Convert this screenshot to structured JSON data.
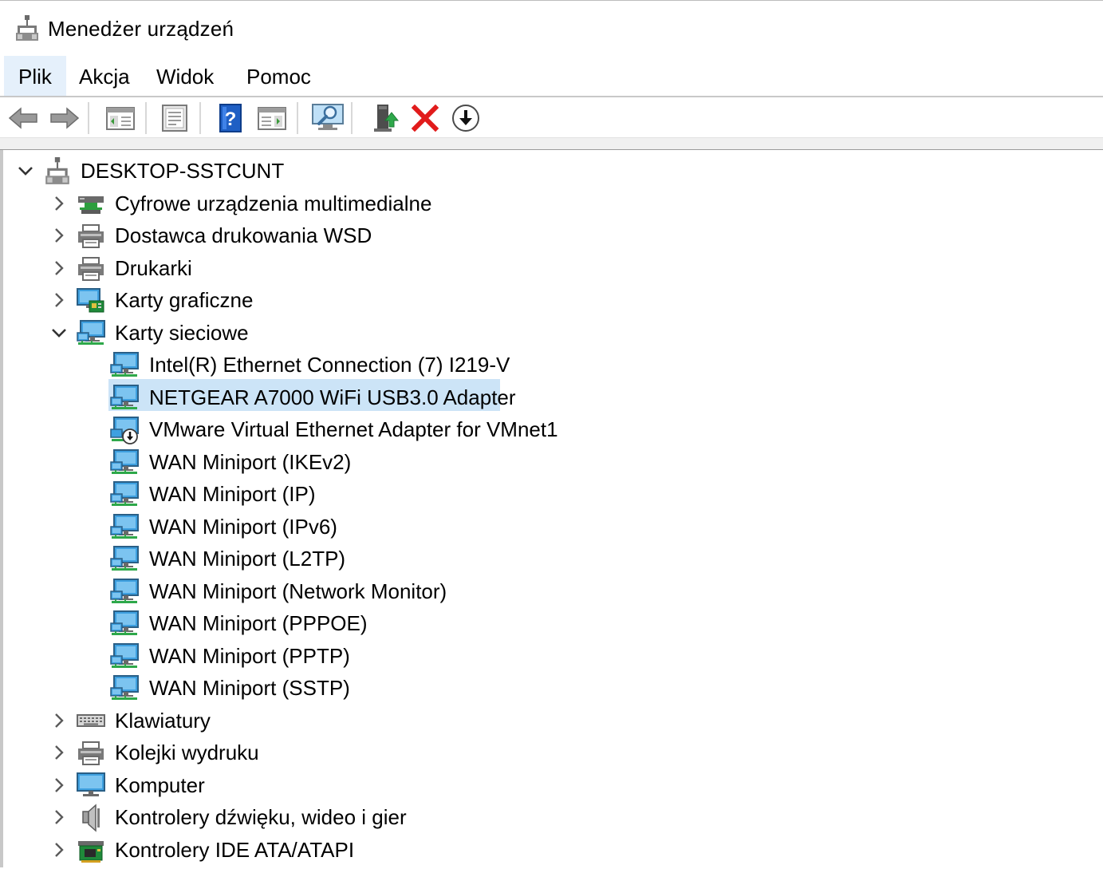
{
  "window": {
    "title": "Menedżer urządzeń",
    "icon": "device-manager-icon"
  },
  "menu": [
    "Plik",
    "Akcja",
    "Widok",
    "Pomoc"
  ],
  "menu_active": "Plik",
  "toolbar": [
    {
      "name": "back-button",
      "icon": "arrow-left-icon"
    },
    {
      "name": "forward-button",
      "icon": "arrow-right-icon"
    },
    {
      "name": "show-hide-console-tree-button",
      "icon": "console-tree-icon"
    },
    {
      "name": "properties-button",
      "icon": "properties-icon"
    },
    {
      "name": "help-button",
      "icon": "help-icon"
    },
    {
      "name": "show-hide-action-pane-button",
      "icon": "action-pane-icon"
    },
    {
      "name": "scan-hardware-button",
      "icon": "monitor-scan-icon"
    },
    {
      "name": "update-driver-button",
      "icon": "update-driver-icon"
    },
    {
      "name": "uninstall-device-button",
      "icon": "red-x-icon"
    },
    {
      "name": "disable-device-button",
      "icon": "download-circle-icon"
    }
  ],
  "tree": {
    "root": {
      "label": "DESKTOP-SSTCUNT",
      "icon": "computer-network-icon",
      "expanded": true
    },
    "categories": [
      {
        "label": "Cyfrowe urządzenia multimedialne",
        "icon": "multimedia-device-icon",
        "expanded": false
      },
      {
        "label": "Dostawca drukowania WSD",
        "icon": "printer-icon",
        "expanded": false
      },
      {
        "label": "Drukarki",
        "icon": "printer-icon",
        "expanded": false
      },
      {
        "label": "Karty graficzne",
        "icon": "display-adapter-icon",
        "expanded": false
      },
      {
        "label": "Karty sieciowe",
        "icon": "network-adapter-icon",
        "expanded": true,
        "children": [
          {
            "label": "Intel(R) Ethernet Connection (7) I219-V",
            "icon": "network-adapter-icon"
          },
          {
            "label": "NETGEAR A7000 WiFi USB3.0 Adapter",
            "icon": "network-adapter-icon",
            "selected": true
          },
          {
            "label": "VMware Virtual Ethernet Adapter for VMnet1",
            "icon": "network-adapter-disabled-icon"
          },
          {
            "label": "WAN Miniport (IKEv2)",
            "icon": "network-adapter-icon"
          },
          {
            "label": "WAN Miniport (IP)",
            "icon": "network-adapter-icon"
          },
          {
            "label": "WAN Miniport (IPv6)",
            "icon": "network-adapter-icon"
          },
          {
            "label": "WAN Miniport (L2TP)",
            "icon": "network-adapter-icon"
          },
          {
            "label": "WAN Miniport (Network Monitor)",
            "icon": "network-adapter-icon"
          },
          {
            "label": "WAN Miniport (PPPOE)",
            "icon": "network-adapter-icon"
          },
          {
            "label": "WAN Miniport (PPTP)",
            "icon": "network-adapter-icon"
          },
          {
            "label": "WAN Miniport (SSTP)",
            "icon": "network-adapter-icon"
          }
        ]
      },
      {
        "label": "Klawiatury",
        "icon": "keyboard-icon",
        "expanded": false
      },
      {
        "label": "Kolejki wydruku",
        "icon": "printer-icon",
        "expanded": false
      },
      {
        "label": "Komputer",
        "icon": "monitor-icon",
        "expanded": false
      },
      {
        "label": "Kontrolery dźwięku, wideo i gier",
        "icon": "speaker-icon",
        "expanded": false
      },
      {
        "label": "Kontrolery IDE ATA/ATAPI",
        "icon": "ide-controller-icon",
        "expanded": false
      }
    ]
  },
  "colors": {
    "selection": "#cce4f7",
    "menu_active": "#e5f0fb",
    "accent": "#1e88d8"
  }
}
